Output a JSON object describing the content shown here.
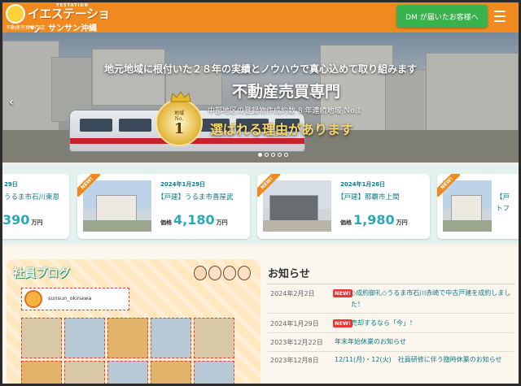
{
  "header": {
    "logo_main": "イエステーション",
    "logo_tagline": "YESTATION",
    "logo_sub": "不動産売買専門店",
    "logo_branch": "サンサン沖縄",
    "dm_button": "DM が届いたお客様へ",
    "menu_icon": "hamburger-icon",
    "brand_color": "#f08a1f",
    "dm_color": "#37b24d"
  },
  "hero": {
    "headline": "地元地域に根付いた２８年の実績とノウハウで真心込めて取り組みます",
    "title": "不動産売買専門",
    "subtitle": "中部地区の登録物件成約数 8 年連続地域 No.1",
    "reason": "選ばれる理由があります",
    "badge_line1": "地域",
    "badge_line2": "No.",
    "badge_number": "1",
    "prev_arrow": "‹",
    "slides_total": 5,
    "slide_active": 1
  },
  "listings": [
    {
      "date": "29日",
      "name": "うるま市石川東恩",
      "price_label": "",
      "price": "390",
      "unit": "万円",
      "new": false
    },
    {
      "date": "2024年1月29日",
      "name": "【戸建】うるま市喜屋武",
      "price_label": "価格",
      "price": "4,180",
      "unit": "万円",
      "new": true,
      "new_label": "NEW!"
    },
    {
      "date": "2024年1月26日",
      "name": "【戸建】那覇市上間",
      "price_label": "価格",
      "price": "1,980",
      "unit": "万円",
      "new": true,
      "new_label": "NEW!"
    },
    {
      "date": "",
      "name": "【戸",
      "sub": "トフ",
      "price_label": "",
      "price": "",
      "unit": "",
      "new": true,
      "new_label": "NEW!"
    }
  ],
  "blog": {
    "title": "社員ブログ",
    "instagram_name": "sunsun_okinawa"
  },
  "news": {
    "title": "お知らせ",
    "items": [
      {
        "date": "2024年2月2日",
        "new": "NEW!",
        "text": "◇成約御礼◇うるま市石川赤崎で中古戸建を成約しました！"
      },
      {
        "date": "2024年1月29日",
        "new": "NEW!",
        "text": "売却するなら「今」！"
      },
      {
        "date": "2023年12月22日",
        "new": "",
        "text": "年末年始休業のお知らせ"
      },
      {
        "date": "2023年12月8日",
        "new": "",
        "text": "12/11(月)・12(火)　社員研修に伴う臨時休業のお知らせ"
      }
    ]
  }
}
